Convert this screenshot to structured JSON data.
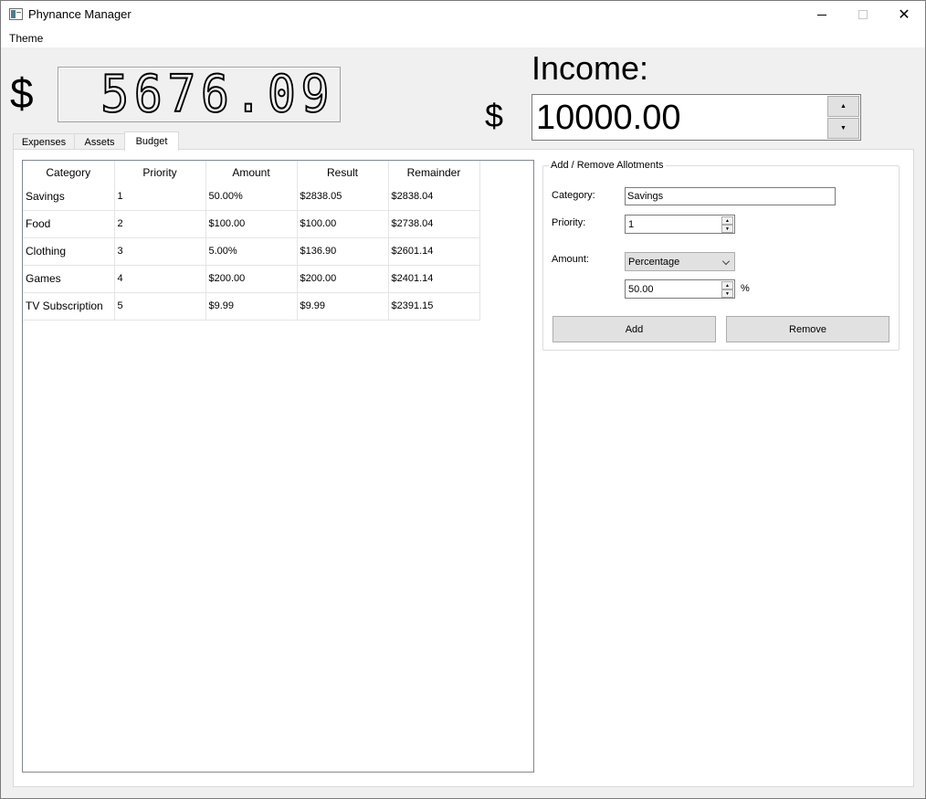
{
  "window": {
    "title": "Phynance Manager",
    "close_glyph": "✕"
  },
  "menu": {
    "theme": "Theme"
  },
  "balance": {
    "currency_symbol": "$",
    "display": "5676.09"
  },
  "income": {
    "label": "Income:",
    "currency_symbol": "$",
    "value": "10000.00",
    "up_glyph": "▲",
    "down_glyph": "▼"
  },
  "tabs": [
    {
      "label": "Expenses"
    },
    {
      "label": "Assets"
    },
    {
      "label": "Budget",
      "selected": true
    }
  ],
  "budget_table": {
    "columns": [
      "Category",
      "Priority",
      "Amount",
      "Result",
      "Remainder"
    ],
    "rows": [
      [
        "Savings",
        "1",
        "50.00%",
        "$2838.05",
        "$2838.04"
      ],
      [
        "Food",
        "2",
        "$100.00",
        "$100.00",
        "$2738.04"
      ],
      [
        "Clothing",
        "3",
        "5.00%",
        "$136.90",
        "$2601.14"
      ],
      [
        "Games",
        "4",
        "$200.00",
        "$200.00",
        "$2401.14"
      ],
      [
        "TV Subscription",
        "5",
        "$9.99",
        "$9.99",
        "$2391.15"
      ]
    ]
  },
  "allotments": {
    "group_title": "Add / Remove Allotments",
    "category_label": "Category:",
    "category_value": "Savings",
    "priority_label": "Priority:",
    "priority_value": "1",
    "amount_label": "Amount:",
    "amount_type": "Percentage",
    "amount_value": "50.00",
    "unit": "%",
    "add_label": "Add",
    "remove_label": "Remove",
    "spin_up_glyph": "▲",
    "spin_down_glyph": "▼"
  }
}
